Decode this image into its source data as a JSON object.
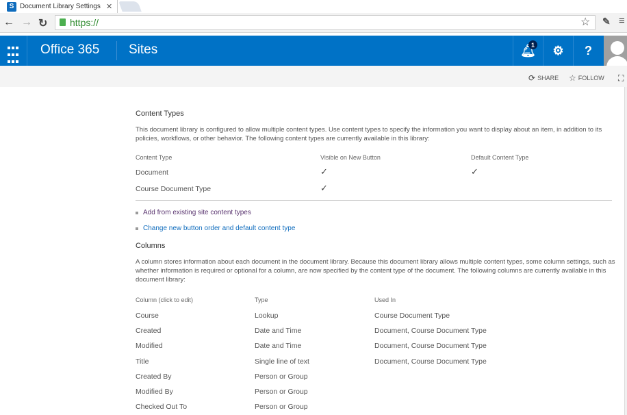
{
  "browser": {
    "tab_title": "Document Library Settings",
    "tab_favicon": "S",
    "url": "https://",
    "icons": {
      "back": "back-arrow-icon",
      "forward": "forward-arrow-icon",
      "reload": "reload-icon",
      "bookmark": "star-icon",
      "extension": "extension-icon",
      "menu": "menu-icon"
    }
  },
  "suitebar": {
    "brand": "Office 365",
    "site": "Sites",
    "notification_count": "1",
    "help_label": "?",
    "bg_color": "#0072c6"
  },
  "actions": {
    "share": "SHARE",
    "follow": "FOLLOW"
  },
  "content_types": {
    "heading": "Content Types",
    "description": "This document library is configured to allow multiple content types. Use content types to specify the information you want to display about an item, in addition to its policies, workflows, or other behavior. The following content types are currently available in this library:",
    "headers": [
      "Content Type",
      "Visible on New Button",
      "Default Content Type"
    ],
    "rows": [
      {
        "name": "Document",
        "visible": true,
        "default": true
      },
      {
        "name": "Course Document Type",
        "visible": true,
        "default": false
      }
    ],
    "check_glyph": "✓",
    "links": [
      "Add from existing site content types",
      "Change new button order and default content type"
    ]
  },
  "columns": {
    "heading": "Columns",
    "description": "A column stores information about each document in the document library. Because this document library allows multiple content types, some column settings, such as whether information is required or optional for a column, are now specified by the content type of the document. The following columns are currently available in this document library:",
    "headers": [
      "Column (click to edit)",
      "Type",
      "Used In"
    ],
    "rows": [
      [
        "Course",
        "Lookup",
        "Course Document Type"
      ],
      [
        "Created",
        "Date and Time",
        "Document, Course Document Type"
      ],
      [
        "Modified",
        "Date and Time",
        "Document, Course Document Type"
      ],
      [
        "Title",
        "Single line of text",
        "Document, Course Document Type"
      ],
      [
        "Created By",
        "Person or Group",
        ""
      ],
      [
        "Modified By",
        "Person or Group",
        ""
      ],
      [
        "Checked Out To",
        "Person or Group",
        ""
      ]
    ]
  }
}
